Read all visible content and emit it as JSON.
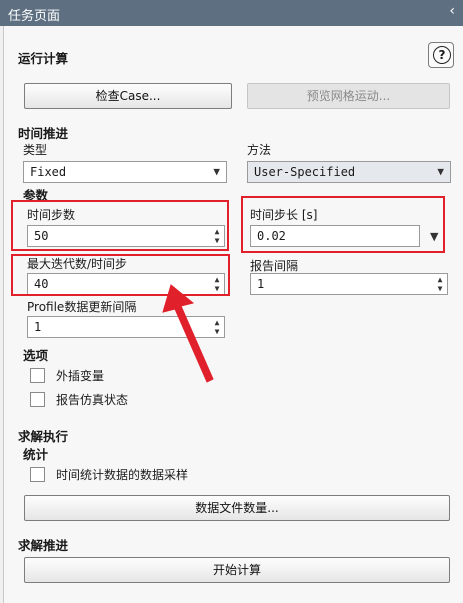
{
  "title": "任务页面",
  "collapse_icon": "chevron-left-icon",
  "run": {
    "heading": "运行计算",
    "help_label": "?",
    "check_case": "检查Case...",
    "preview_mesh": "预览网格运动..."
  },
  "time_advance": {
    "heading": "时间推进",
    "type_label": "类型",
    "type_value": "Fixed",
    "method_label": "方法",
    "method_value": "User-Specified"
  },
  "params": {
    "heading": "参数",
    "time_step_count_label": "时间步数",
    "time_step_count_value": "50",
    "time_step_size_label": "时间步长 [s]",
    "time_step_size_value": "0.02",
    "max_iter_label": "最大迭代数/时间步",
    "max_iter_value": "40",
    "report_interval_label": "报告间隔",
    "report_interval_value": "1",
    "profile_update_label": "Profile数据更新间隔",
    "profile_update_value": "1"
  },
  "options": {
    "heading": "选项",
    "extrapolate": "外插变量",
    "report_sim_status": "报告仿真状态"
  },
  "solution": {
    "heading": "求解执行",
    "stats_heading": "统计",
    "sampling": "时间统计数据的数据采样",
    "data_file_qty": "数据文件数量..."
  },
  "solve_advance": {
    "heading": "求解推进",
    "start_calc": "开始计算"
  },
  "annotation_color": "#e0202a"
}
